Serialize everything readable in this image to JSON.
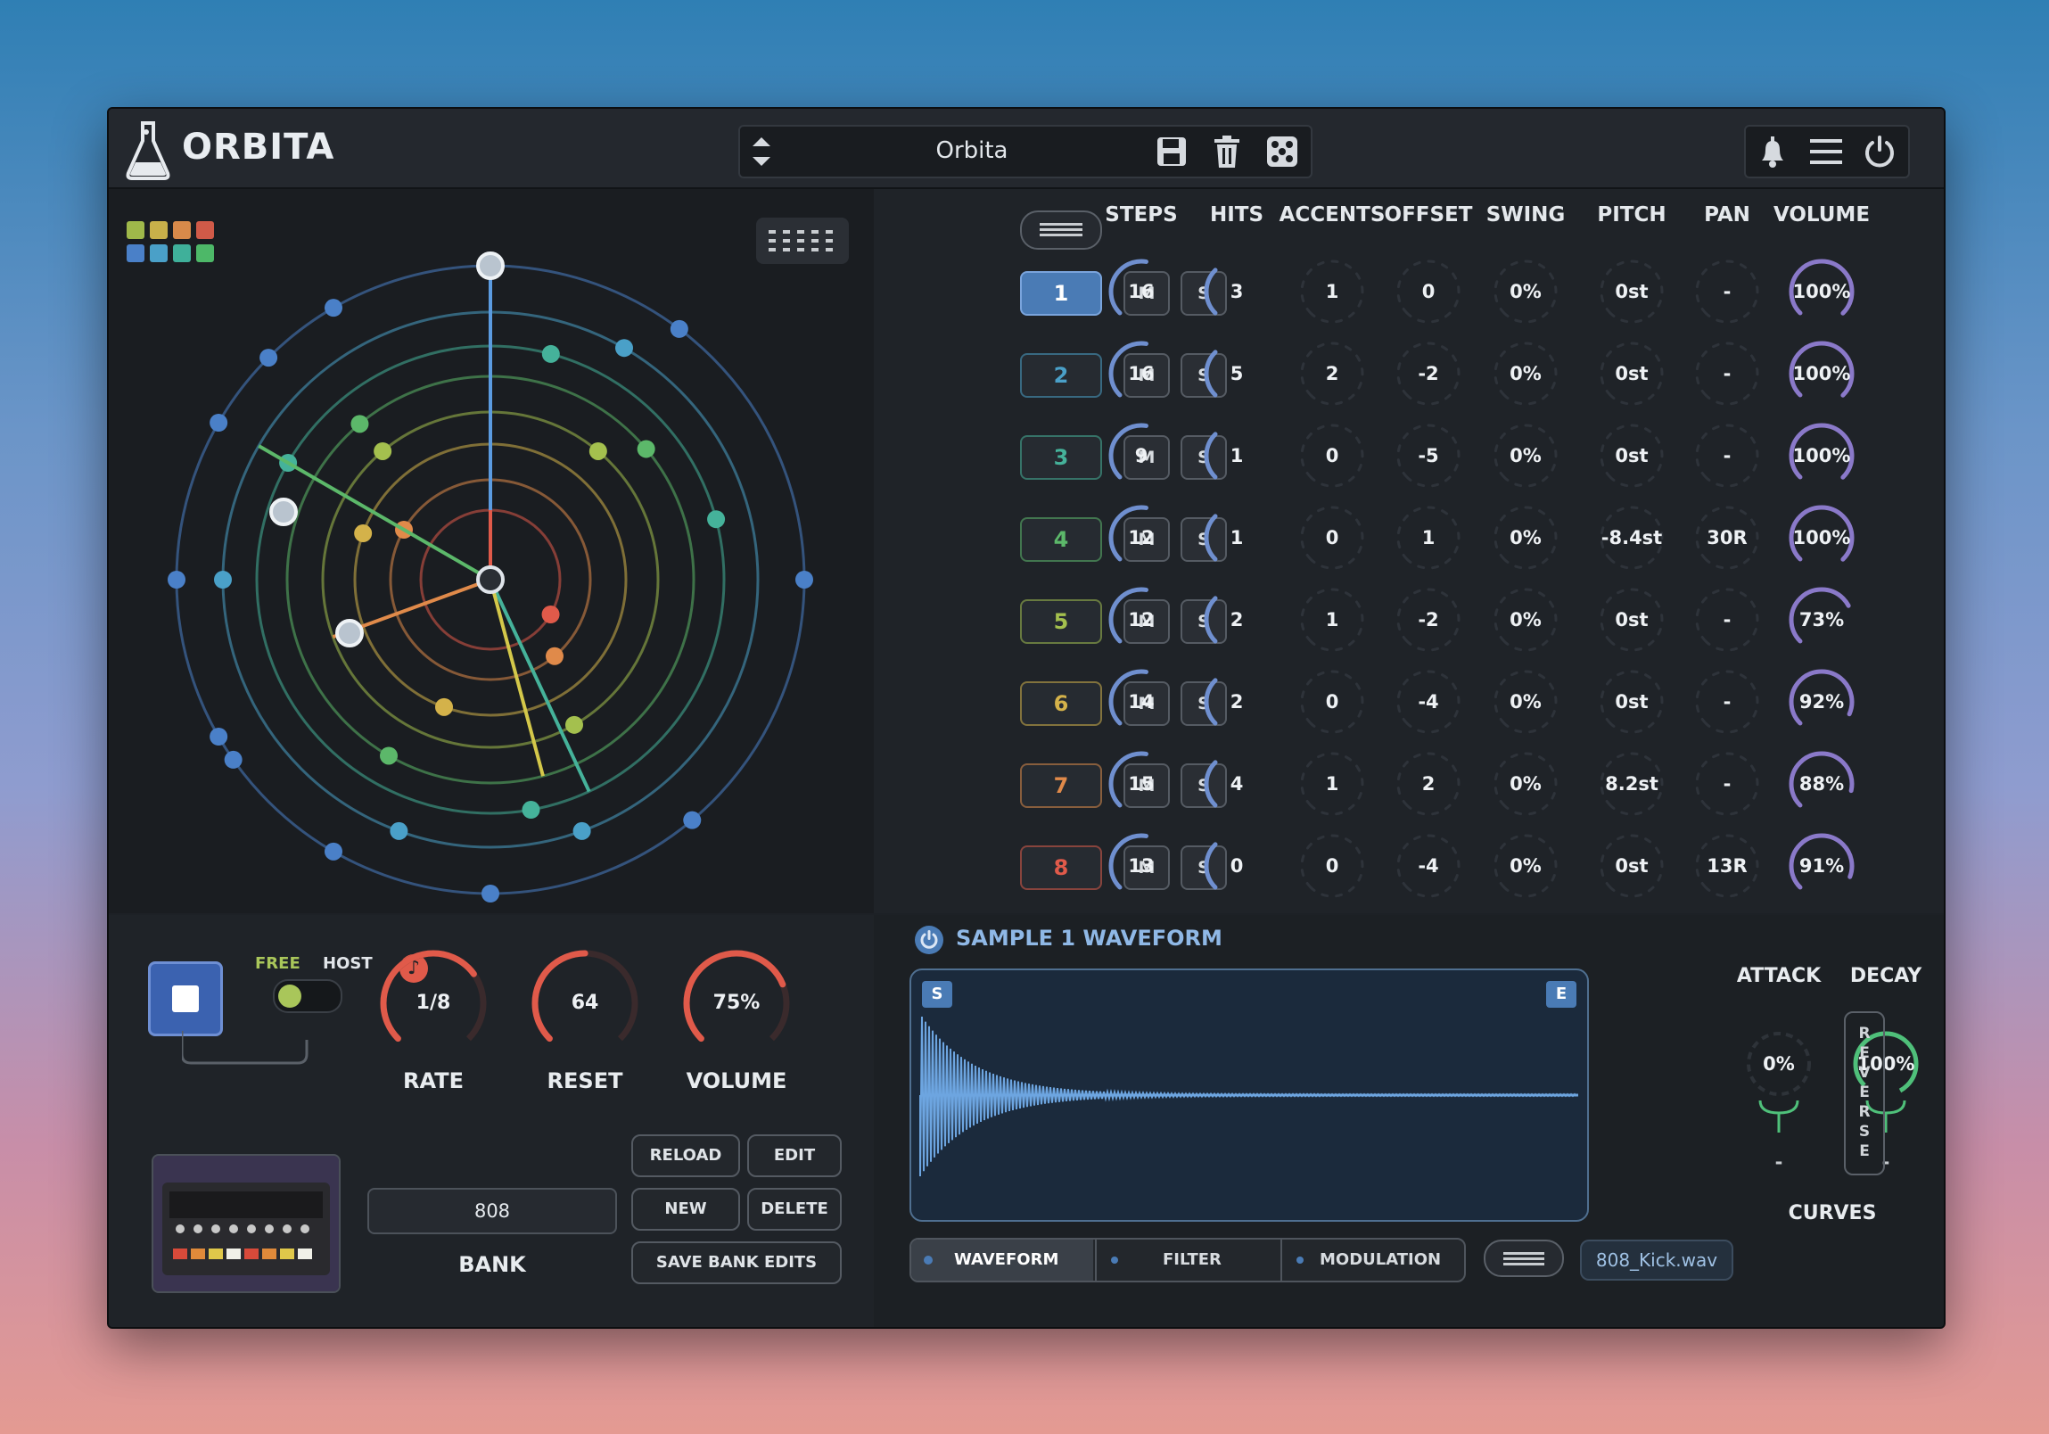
{
  "app": {
    "title": "ORBITA",
    "preset_name": "Orbita"
  },
  "icons": {
    "logo": "flask-icon",
    "preset_up_down": "chevron-up-down-icon",
    "save": "save-icon",
    "trash": "trash-icon",
    "random": "dice-icon",
    "bell": "bell-icon",
    "menu": "hamburger-icon",
    "power": "power-icon"
  },
  "colors": {
    "accent": "#4a7bb5",
    "knob_arc": "#6f8fcf",
    "red_knob": "#e05a4a",
    "green_knob": "#4fc07a",
    "volume_arc": "#8a79c9"
  },
  "track_columns": [
    "STEPS",
    "HITS",
    "ACCENTS",
    "OFFSET",
    "SWING",
    "PITCH",
    "PAN",
    "VOLUME"
  ],
  "mute_label": "M",
  "solo_label": "S",
  "tracks": [
    {
      "num": "1",
      "steps": "16",
      "hits": "3",
      "accents": "1",
      "offset": "0",
      "swing": "0%",
      "pitch": "0st",
      "pan": "-",
      "volume": "100%",
      "color": "#6f9fe0"
    },
    {
      "num": "2",
      "steps": "16",
      "hits": "5",
      "accents": "2",
      "offset": "-2",
      "swing": "0%",
      "pitch": "0st",
      "pan": "-",
      "volume": "100%",
      "color": "#4aa0c8"
    },
    {
      "num": "3",
      "steps": "9",
      "hits": "1",
      "accents": "0",
      "offset": "-5",
      "swing": "0%",
      "pitch": "0st",
      "pan": "-",
      "volume": "100%",
      "color": "#45b29a"
    },
    {
      "num": "4",
      "steps": "12",
      "hits": "1",
      "accents": "0",
      "offset": "1",
      "swing": "0%",
      "pitch": "-8.4st",
      "pan": "30R",
      "volume": "100%",
      "color": "#5cb86a"
    },
    {
      "num": "5",
      "steps": "12",
      "hits": "2",
      "accents": "1",
      "offset": "-2",
      "swing": "0%",
      "pitch": "0st",
      "pan": "-",
      "volume": "73%",
      "color": "#a4c04e"
    },
    {
      "num": "6",
      "steps": "14",
      "hits": "2",
      "accents": "0",
      "offset": "-4",
      "swing": "0%",
      "pitch": "0st",
      "pan": "-",
      "volume": "92%",
      "color": "#d4b24a"
    },
    {
      "num": "7",
      "steps": "15",
      "hits": "4",
      "accents": "1",
      "offset": "2",
      "swing": "0%",
      "pitch": "8.2st",
      "pan": "-",
      "volume": "88%",
      "color": "#e08a4a"
    },
    {
      "num": "8",
      "steps": "13",
      "hits": "0",
      "accents": "0",
      "offset": "-4",
      "swing": "0%",
      "pitch": "0st",
      "pan": "13R",
      "volume": "91%",
      "color": "#e05a4a"
    }
  ],
  "transport": {
    "free_label": "FREE",
    "host_label": "HOST"
  },
  "main_knobs": [
    {
      "value": "1/8",
      "label": "RATE",
      "level": 0.7
    },
    {
      "value": "64",
      "label": "RESET",
      "level": 0.5
    },
    {
      "value": "75%",
      "label": "VOLUME",
      "level": 0.75
    }
  ],
  "bank": {
    "value": "808",
    "label": "BANK",
    "reload": "RELOAD",
    "edit": "EDIT",
    "new": "NEW",
    "delete": "DELETE",
    "save_edits": "SAVE BANK EDITS"
  },
  "sample": {
    "title": "SAMPLE 1 WAVEFORM",
    "start_marker": "S",
    "end_marker": "E",
    "file": "808_Kick.wav"
  },
  "envelope": {
    "attack_label": "ATTACK",
    "decay_label": "DECAY",
    "attack_value": "0%",
    "decay_value": "100%",
    "attack_curve": "-",
    "decay_curve": "-",
    "curves_label": "CURVES",
    "reverse_letters": [
      "R",
      "E",
      "V",
      "E",
      "R",
      "S",
      "E"
    ]
  },
  "tabs": [
    {
      "label": "WAVEFORM",
      "active": true
    },
    {
      "label": "FILTER",
      "active": false
    },
    {
      "label": "MODULATION",
      "active": false
    }
  ]
}
